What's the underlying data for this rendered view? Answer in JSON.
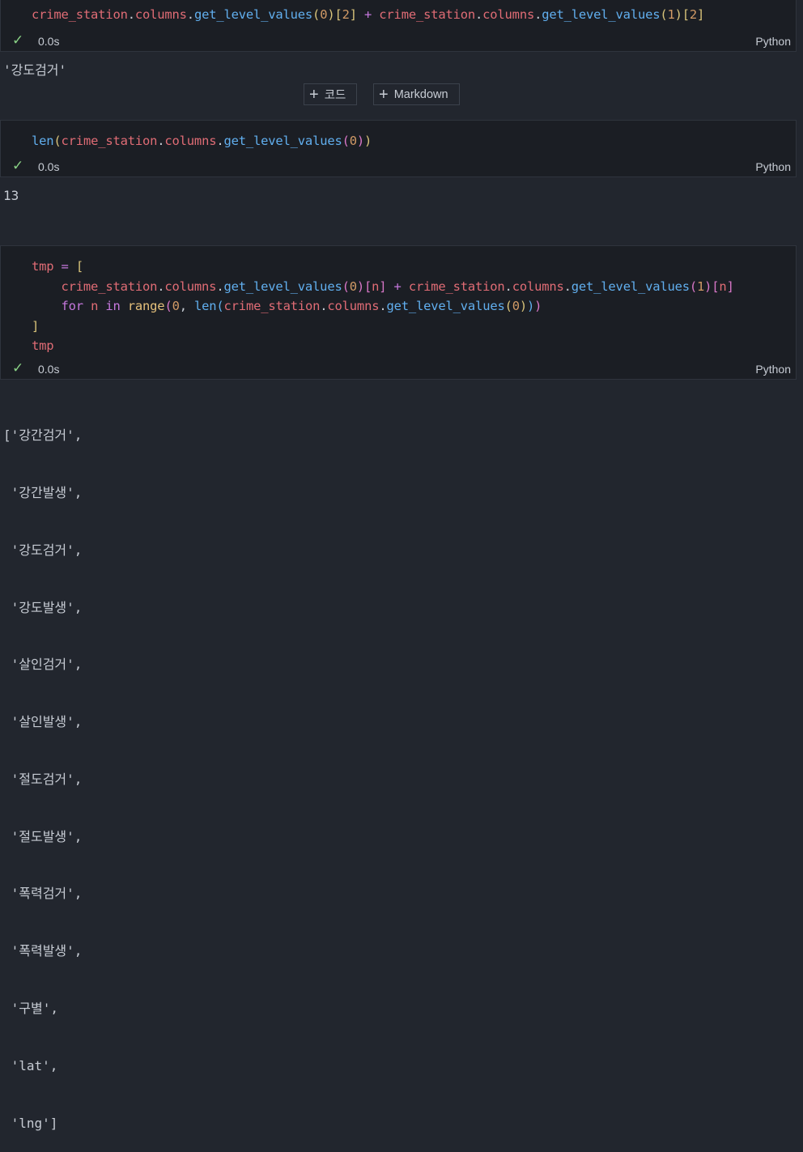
{
  "cells": [
    {
      "status": {
        "time": "0.0s",
        "language": "Python"
      },
      "output": "'강도검거'"
    },
    {
      "status": {
        "time": "0.0s",
        "language": "Python"
      },
      "output": "13"
    },
    {
      "status": {
        "time": "0.0s",
        "language": "Python"
      },
      "output_lines": [
        "['강간검거',",
        " '강간발생',",
        " '강도검거',",
        " '강도발생',",
        " '살인검거',",
        " '살인발생',",
        " '절도검거',",
        " '절도발생',",
        " '폭력검거',",
        " '폭력발생',",
        " '구별',",
        " 'lat',",
        " 'lng']"
      ]
    }
  ],
  "toolbar": {
    "add_code_label": "코드",
    "add_markdown_label": "Markdown"
  },
  "icons": {
    "check": "check-icon",
    "plus": "plus-icon"
  }
}
